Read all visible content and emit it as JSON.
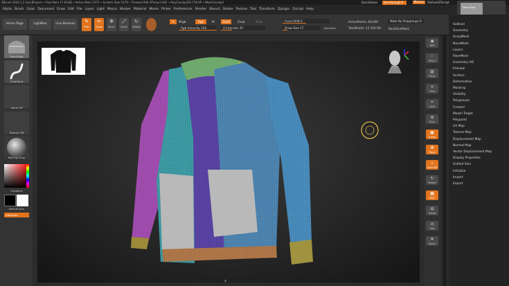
{
  "title_bar": {
    "text": "ZBrush 2020.1.2    [sim]Project    • Free Mem 17.61GB • Active Mem 5375 • Scratch Disk 5179 • Timer▸0.004 ATime▸1.045 • PolyCount▸202.716 KP • MeshCount▸5"
  },
  "menu": [
    "Alpha",
    "Brush",
    "Color",
    "Document",
    "Draw",
    "Edit",
    "File",
    "Layer",
    "Light",
    "Macro",
    "Marker",
    "Material",
    "Movie",
    "Picker",
    "Preferences",
    "Render",
    "Stencil",
    "Stroke",
    "Texture",
    "Tool",
    "Transform",
    "Zplugin",
    "Zscript",
    "Help"
  ],
  "topright": {
    "quicksave": "QuickSave",
    "seethrough": "See-through  0",
    "menus": "Menus",
    "script": "DefaultZScript"
  },
  "shelf": {
    "home": "Home Page",
    "lightbox": "LightBox",
    "live_boolean": "Live Boolean",
    "tools": [
      {
        "label": "Edit",
        "glyph": "✎"
      },
      {
        "label": "Draw",
        "glyph": "✏"
      },
      {
        "label": "Move",
        "glyph": "✥"
      },
      {
        "label": "Scale",
        "glyph": "⤢"
      },
      {
        "label": "Rotate",
        "glyph": "↻"
      }
    ],
    "a_label": "A",
    "mrgb": "Mrgb",
    "rgb": "Rgb",
    "m_label": "M",
    "zadd": "Zadd",
    "zsub": "Zsub",
    "zcut": "Zcut",
    "rgb_intensity": "Rgb Intensity 100",
    "rgb_intensity_value": 100,
    "z_intensity": "Z Intensity 25",
    "z_intensity_value": 25,
    "focal_shift": "Focal Shift 0",
    "focal_shift_value": 0,
    "draw_size": "Draw Size 17",
    "draw_size_value": 17,
    "dynamic": "Dynamic",
    "active_points": "ActivePoints: 46,006",
    "total_points": "TotalPoints: 13.104 Mil",
    "mask_by_polygroups": "Mask By Polygroups 0",
    "backface_mask": "BackfaceMask"
  },
  "left_tray": {
    "brush": "MoveTopo",
    "stroke": "FreeHand",
    "alpha": "Alpha Off",
    "texture": "Texture Off",
    "material": "MatCap Gray",
    "gradient": "Gradient",
    "switch_color": "SwitchColor",
    "alternate": "Alternate"
  },
  "right_tools": [
    {
      "label": "BPR",
      "glyph": "◉"
    },
    {
      "label": "SPix 3",
      "glyph": "∷"
    },
    {
      "label": "Persp",
      "glyph": "▨"
    },
    {
      "label": "Floor",
      "glyph": "⌗"
    },
    {
      "label": "Local",
      "glyph": "⌖"
    },
    {
      "label": "Gxyz",
      "glyph": "⊕"
    },
    {
      "label": "Frame",
      "glyph": "▣"
    },
    {
      "label": "Move",
      "glyph": "✥"
    },
    {
      "label": "Zoom3D",
      "glyph": "⌕"
    },
    {
      "label": "Rotate",
      "glyph": "↻"
    },
    {
      "label": "PolyF",
      "glyph": "▦"
    },
    {
      "label": "Transp",
      "glyph": "◍"
    },
    {
      "label": "Solo",
      "glyph": "◎"
    },
    {
      "label": "Xpose",
      "glyph": "✷"
    }
  ],
  "subtools": [
    "Subtool",
    "Geometry",
    "ArrayMesh",
    "NanoMesh",
    "Layers",
    "FiberMesh",
    "Geometry HD",
    "Preview",
    "Surface",
    "Deformation",
    "Masking",
    "Visibility",
    "Polygroups",
    "Contact",
    "Morph Target",
    "Polypaint",
    "UV Map",
    "Texture Map",
    "Displacement Map",
    "Normal Map",
    "Vector Displacement Map",
    "Display Properties",
    "Unified Skin",
    "Initialize",
    "Import",
    "Export"
  ],
  "tool_thumb": "FabricFold",
  "colors": {
    "accent": "#e2741d",
    "jacket_blue": "#4f88b5",
    "jacket_teal": "#3e9ea8",
    "jacket_purple": "#a64fb5",
    "shirt_violet": "#5b45a8",
    "pocket_grey": "#b9b9b9",
    "cuff_gold": "#9c8a3a",
    "hem_orange": "#b47a4a"
  }
}
